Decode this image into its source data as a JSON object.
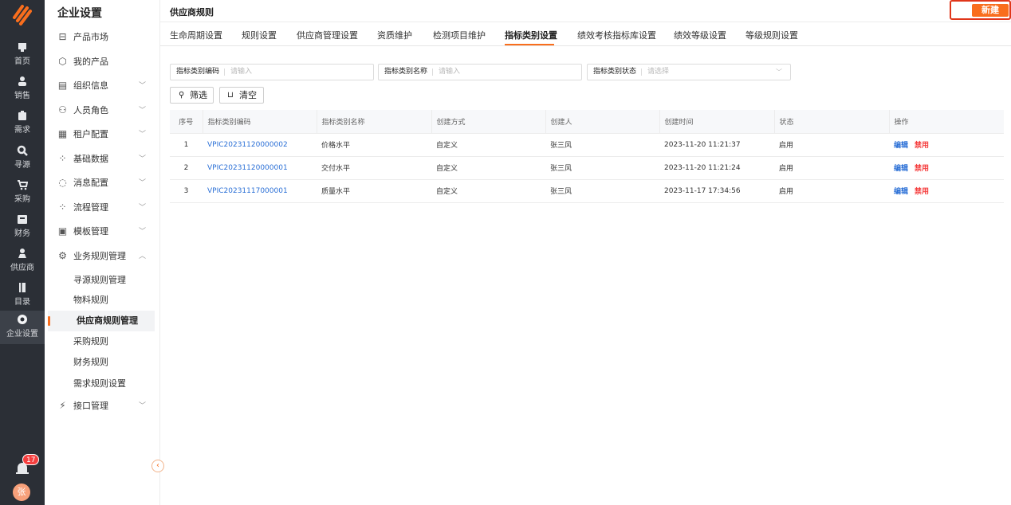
{
  "rail": {
    "items": [
      {
        "label": "首页",
        "icon": "home-icon"
      },
      {
        "label": "销售",
        "icon": "sales-icon"
      },
      {
        "label": "需求",
        "icon": "demand-icon"
      },
      {
        "label": "寻源",
        "icon": "sourcing-icon"
      },
      {
        "label": "采购",
        "icon": "cart-icon"
      },
      {
        "label": "财务",
        "icon": "finance-icon"
      },
      {
        "label": "供应商",
        "icon": "supplier-icon"
      },
      {
        "label": "目录",
        "icon": "catalog-icon"
      },
      {
        "label": "企业设置",
        "icon": "settings-icon"
      }
    ],
    "notification_count": "17",
    "avatar_text": "张"
  },
  "sidebar": {
    "title": "企业设置",
    "items": [
      {
        "label": "产品市场",
        "icon": "market-icon"
      },
      {
        "label": "我的产品",
        "icon": "product-icon"
      },
      {
        "label": "组织信息",
        "icon": "org-icon"
      },
      {
        "label": "人员角色",
        "icon": "people-icon"
      },
      {
        "label": "租户配置",
        "icon": "tenant-icon"
      },
      {
        "label": "基础数据",
        "icon": "data-icon"
      },
      {
        "label": "消息配置",
        "icon": "message-icon"
      },
      {
        "label": "流程管理",
        "icon": "flow-icon"
      },
      {
        "label": "模板管理",
        "icon": "template-icon"
      },
      {
        "label": "业务规则管理",
        "icon": "rule-gear-icon"
      },
      {
        "label": "接口管理",
        "icon": "api-icon"
      }
    ],
    "sub_items": [
      "寻源规则管理",
      "物料规则",
      "供应商规则管理",
      "采购规则",
      "财务规则",
      "需求规则设置"
    ]
  },
  "header": {
    "title": "供应商规则",
    "new_label": "新建"
  },
  "tabs": [
    "生命周期设置",
    "规则设置",
    "供应商管理设置",
    "资质维护",
    "检测项目维护",
    "指标类别设置",
    "绩效考核指标库设置",
    "绩效等级设置",
    "等级规则设置"
  ],
  "filters": [
    {
      "label": "指标类别编码",
      "placeholder": "请输入"
    },
    {
      "label": "指标类别名称",
      "placeholder": "请输入"
    },
    {
      "label": "指标类别状态",
      "placeholder": "请选择"
    }
  ],
  "buttons": {
    "filter": "筛选",
    "clear": "清空"
  },
  "table": {
    "columns": [
      "序号",
      "指标类别编码",
      "指标类别名称",
      "创建方式",
      "创建人",
      "创建时间",
      "状态",
      "操作"
    ],
    "rows": [
      {
        "no": "1",
        "code": "VPIC20231120000002",
        "name": "价格水平",
        "method": "自定义",
        "creator": "张三风",
        "time": "2023-11-20 11:21:37",
        "status": "启用",
        "edit": "编辑",
        "disable": "禁用"
      },
      {
        "no": "2",
        "code": "VPIC20231120000001",
        "name": "交付水平",
        "method": "自定义",
        "creator": "张三风",
        "time": "2023-11-20 11:21:24",
        "status": "启用",
        "edit": "编辑",
        "disable": "禁用"
      },
      {
        "no": "3",
        "code": "VPIC20231117000001",
        "name": "质量水平",
        "method": "自定义",
        "creator": "张三风",
        "time": "2023-11-17 17:34:56",
        "status": "启用",
        "edit": "编辑",
        "disable": "禁用"
      }
    ]
  },
  "colors": {
    "accent": "#f96e1d",
    "link": "#2a6fd6",
    "danger": "#f53f3f",
    "rail_bg": "#2b2f36"
  }
}
